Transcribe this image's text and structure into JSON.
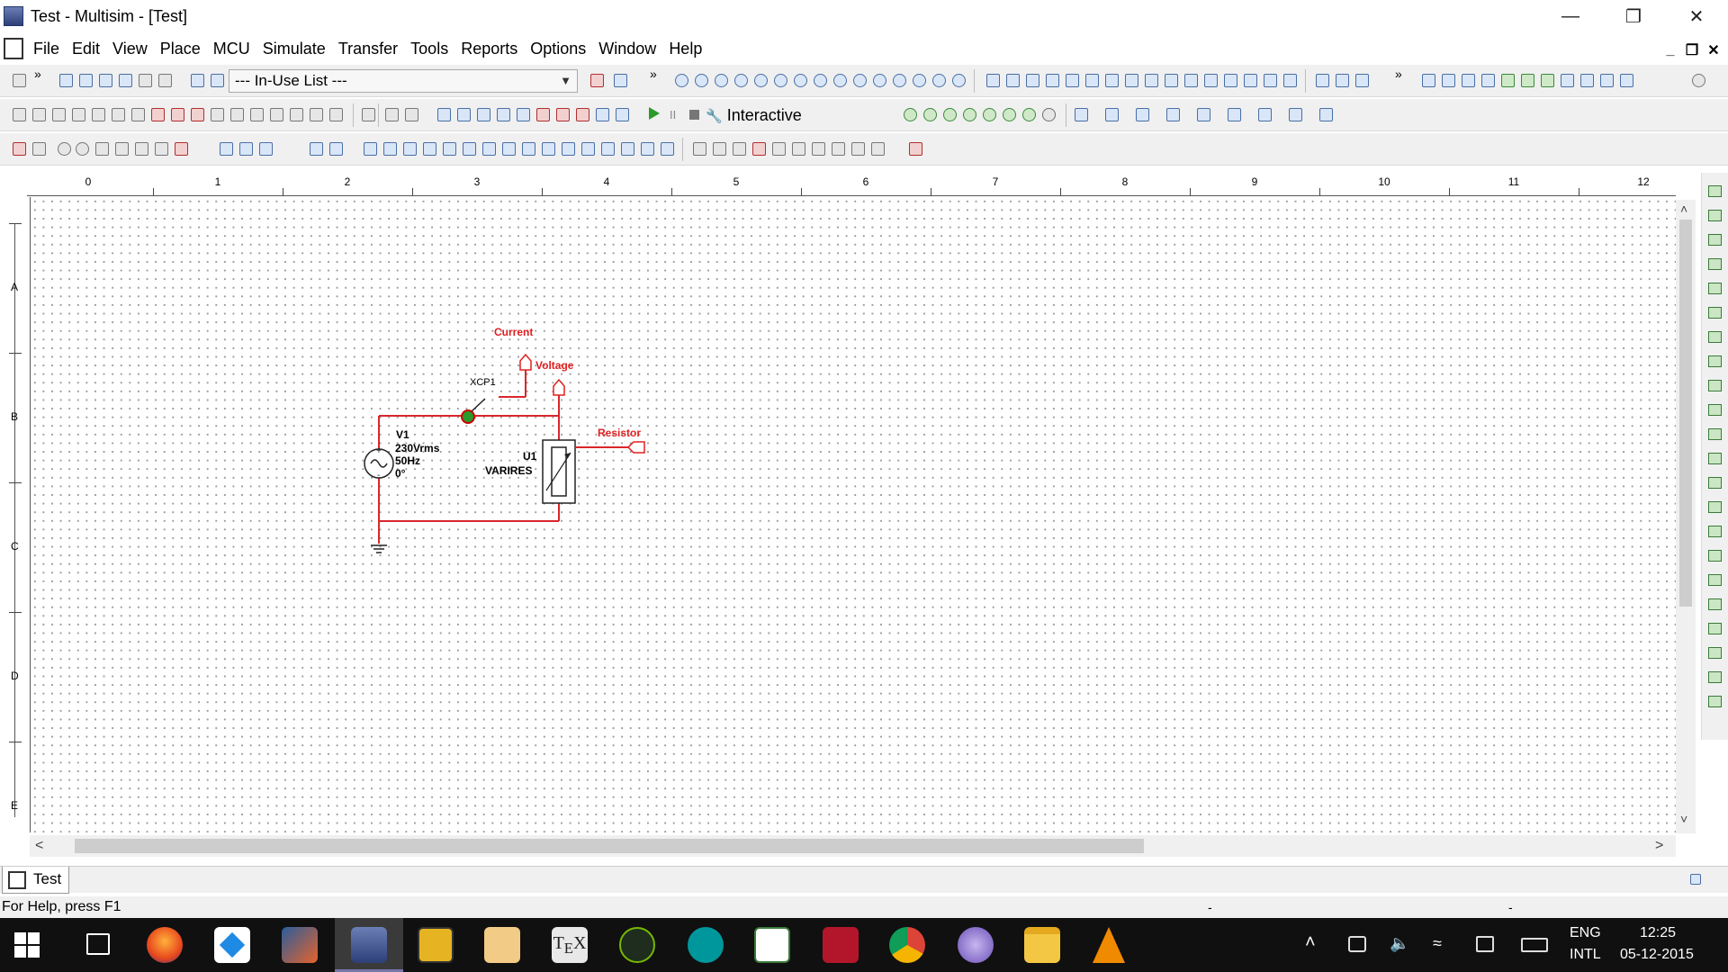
{
  "window": {
    "title": "Test - Multisim - [Test]",
    "minimize": "—",
    "restore": "❐",
    "close": "✕"
  },
  "menu": {
    "items": [
      "File",
      "Edit",
      "View",
      "Place",
      "MCU",
      "Simulate",
      "Transfer",
      "Tools",
      "Reports",
      "Options",
      "Window",
      "Help"
    ],
    "mdi_minimize": "_",
    "mdi_restore": "❐",
    "mdi_close": "✕"
  },
  "toolbar": {
    "in_use_list": "--- In-Use List ---",
    "overflow": "»",
    "interactive": "Interactive",
    "pause": "II"
  },
  "ruler": {
    "columns": [
      "0",
      "1",
      "2",
      "3",
      "4",
      "5",
      "6",
      "7",
      "8",
      "9",
      "10",
      "11",
      "12"
    ],
    "rows": [
      "A",
      "B",
      "C",
      "D",
      "E"
    ]
  },
  "schematic": {
    "probes": [
      {
        "label": "Current"
      },
      {
        "label": "Voltage"
      },
      {
        "label": "Resistor"
      }
    ],
    "probe_ref": "XCP1",
    "source": {
      "ref": "V1",
      "voltage": "230Vrms",
      "freq": "50Hz",
      "phase": "0°"
    },
    "resistor": {
      "ref": "U1",
      "value": "VARIRES"
    },
    "wire_color": "#d9262c",
    "probe_color": "#e02020"
  },
  "tabs": [
    {
      "label": "Test"
    }
  ],
  "status": {
    "text": "For Help, press F1",
    "sep1": "-",
    "sep2": "-"
  },
  "taskbar": {
    "apps": [
      "firefox-icon",
      "dropbox-icon",
      "matlab-icon",
      "multisim-icon",
      "media-icon",
      "archive-icon",
      "tex-icon",
      "nvidia-icon",
      "arduino-icon",
      "diagram-icon",
      "mendeley-icon",
      "chrome-icon",
      "app-icon",
      "file-explorer-icon",
      "vlc-icon"
    ],
    "lang_top": "ENG",
    "lang_bottom": "INTL",
    "time": "12:25",
    "date": "05-12-2015"
  }
}
